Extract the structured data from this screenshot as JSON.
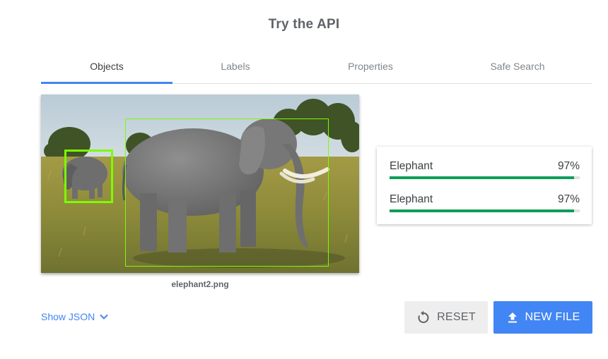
{
  "page": {
    "title": "Try the API"
  },
  "tabs": [
    {
      "label": "Objects",
      "active": true
    },
    {
      "label": "Labels",
      "active": false
    },
    {
      "label": "Properties",
      "active": false
    },
    {
      "label": "Safe Search",
      "active": false
    }
  ],
  "image": {
    "filename": "elephant2.png"
  },
  "results": [
    {
      "name": "Elephant",
      "score_text": "97%",
      "score": 0.97
    },
    {
      "name": "Elephant",
      "score_text": "97%",
      "score": 0.97
    }
  ],
  "footer": {
    "show_json_label": "Show JSON",
    "reset_label": "RESET",
    "new_file_label": "NEW FILE"
  },
  "colors": {
    "accent": "#4285f4",
    "score_bar": "#0f9d58",
    "bounding_box": "#7cfc00"
  },
  "icons": {
    "show_json": "chevron-down-icon",
    "reset": "reset-icon",
    "new_file": "upload-icon"
  }
}
